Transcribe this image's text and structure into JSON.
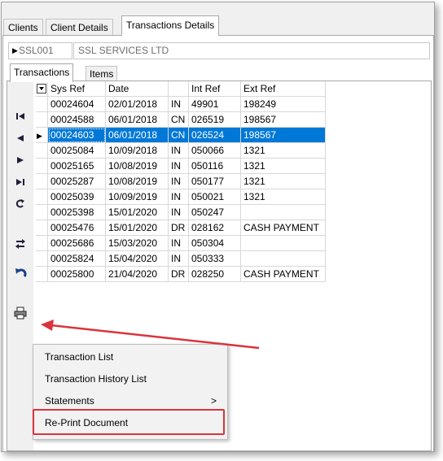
{
  "tabs": [
    {
      "label": "Clients"
    },
    {
      "label": "Client Details"
    },
    {
      "label": "Transactions Details"
    }
  ],
  "client": {
    "code": "SSL001",
    "name": "SSL SERVICES LTD"
  },
  "subtabs": [
    {
      "label": "Transactions"
    },
    {
      "label": "Items"
    }
  ],
  "navigator_icons": [
    "first-record-icon",
    "prior-record-icon",
    "next-record-icon",
    "last-record-icon",
    "refresh-icon",
    "swap-icon",
    "undo-icon",
    "print-icon"
  ],
  "table": {
    "columns": [
      "Sys Ref",
      "Date",
      "",
      "Int Ref",
      "Ext Ref"
    ],
    "rows": [
      [
        "00024604",
        "02/01/2018",
        "IN",
        "49901",
        "198249"
      ],
      [
        "00024588",
        "06/01/2018",
        "CN",
        "026519",
        "198567"
      ],
      [
        "00024603",
        "06/01/2018",
        "CN",
        "026524",
        "198567"
      ],
      [
        "00025084",
        "10/09/2018",
        "IN",
        "050066",
        "1321"
      ],
      [
        "00025165",
        "10/08/2019",
        "IN",
        "050116",
        "1321"
      ],
      [
        "00025287",
        "10/08/2019",
        "IN",
        "050177",
        "1321"
      ],
      [
        "00025039",
        "10/09/2019",
        "IN",
        "050021",
        "1321"
      ],
      [
        "00025398",
        "15/01/2020",
        "IN",
        "050247",
        ""
      ],
      [
        "00025476",
        "15/01/2020",
        "DR",
        "028162",
        "CASH PAYMENT"
      ],
      [
        "00025686",
        "15/03/2020",
        "IN",
        "050304",
        ""
      ],
      [
        "00025824",
        "15/04/2020",
        "IN",
        "050333",
        ""
      ],
      [
        "00025800",
        "21/04/2020",
        "DR",
        "028250",
        "CASH PAYMENT"
      ]
    ],
    "selected_row": 2
  },
  "menu": {
    "items": [
      {
        "label": "Transaction List"
      },
      {
        "label": "Transaction History List"
      },
      {
        "label": "Statements",
        "submenu": true
      },
      {
        "label": "Re-Print Document"
      }
    ],
    "submenu_arrow": ">"
  },
  "colors": {
    "selection": "#0078d7",
    "annotation": "#d9343c"
  }
}
